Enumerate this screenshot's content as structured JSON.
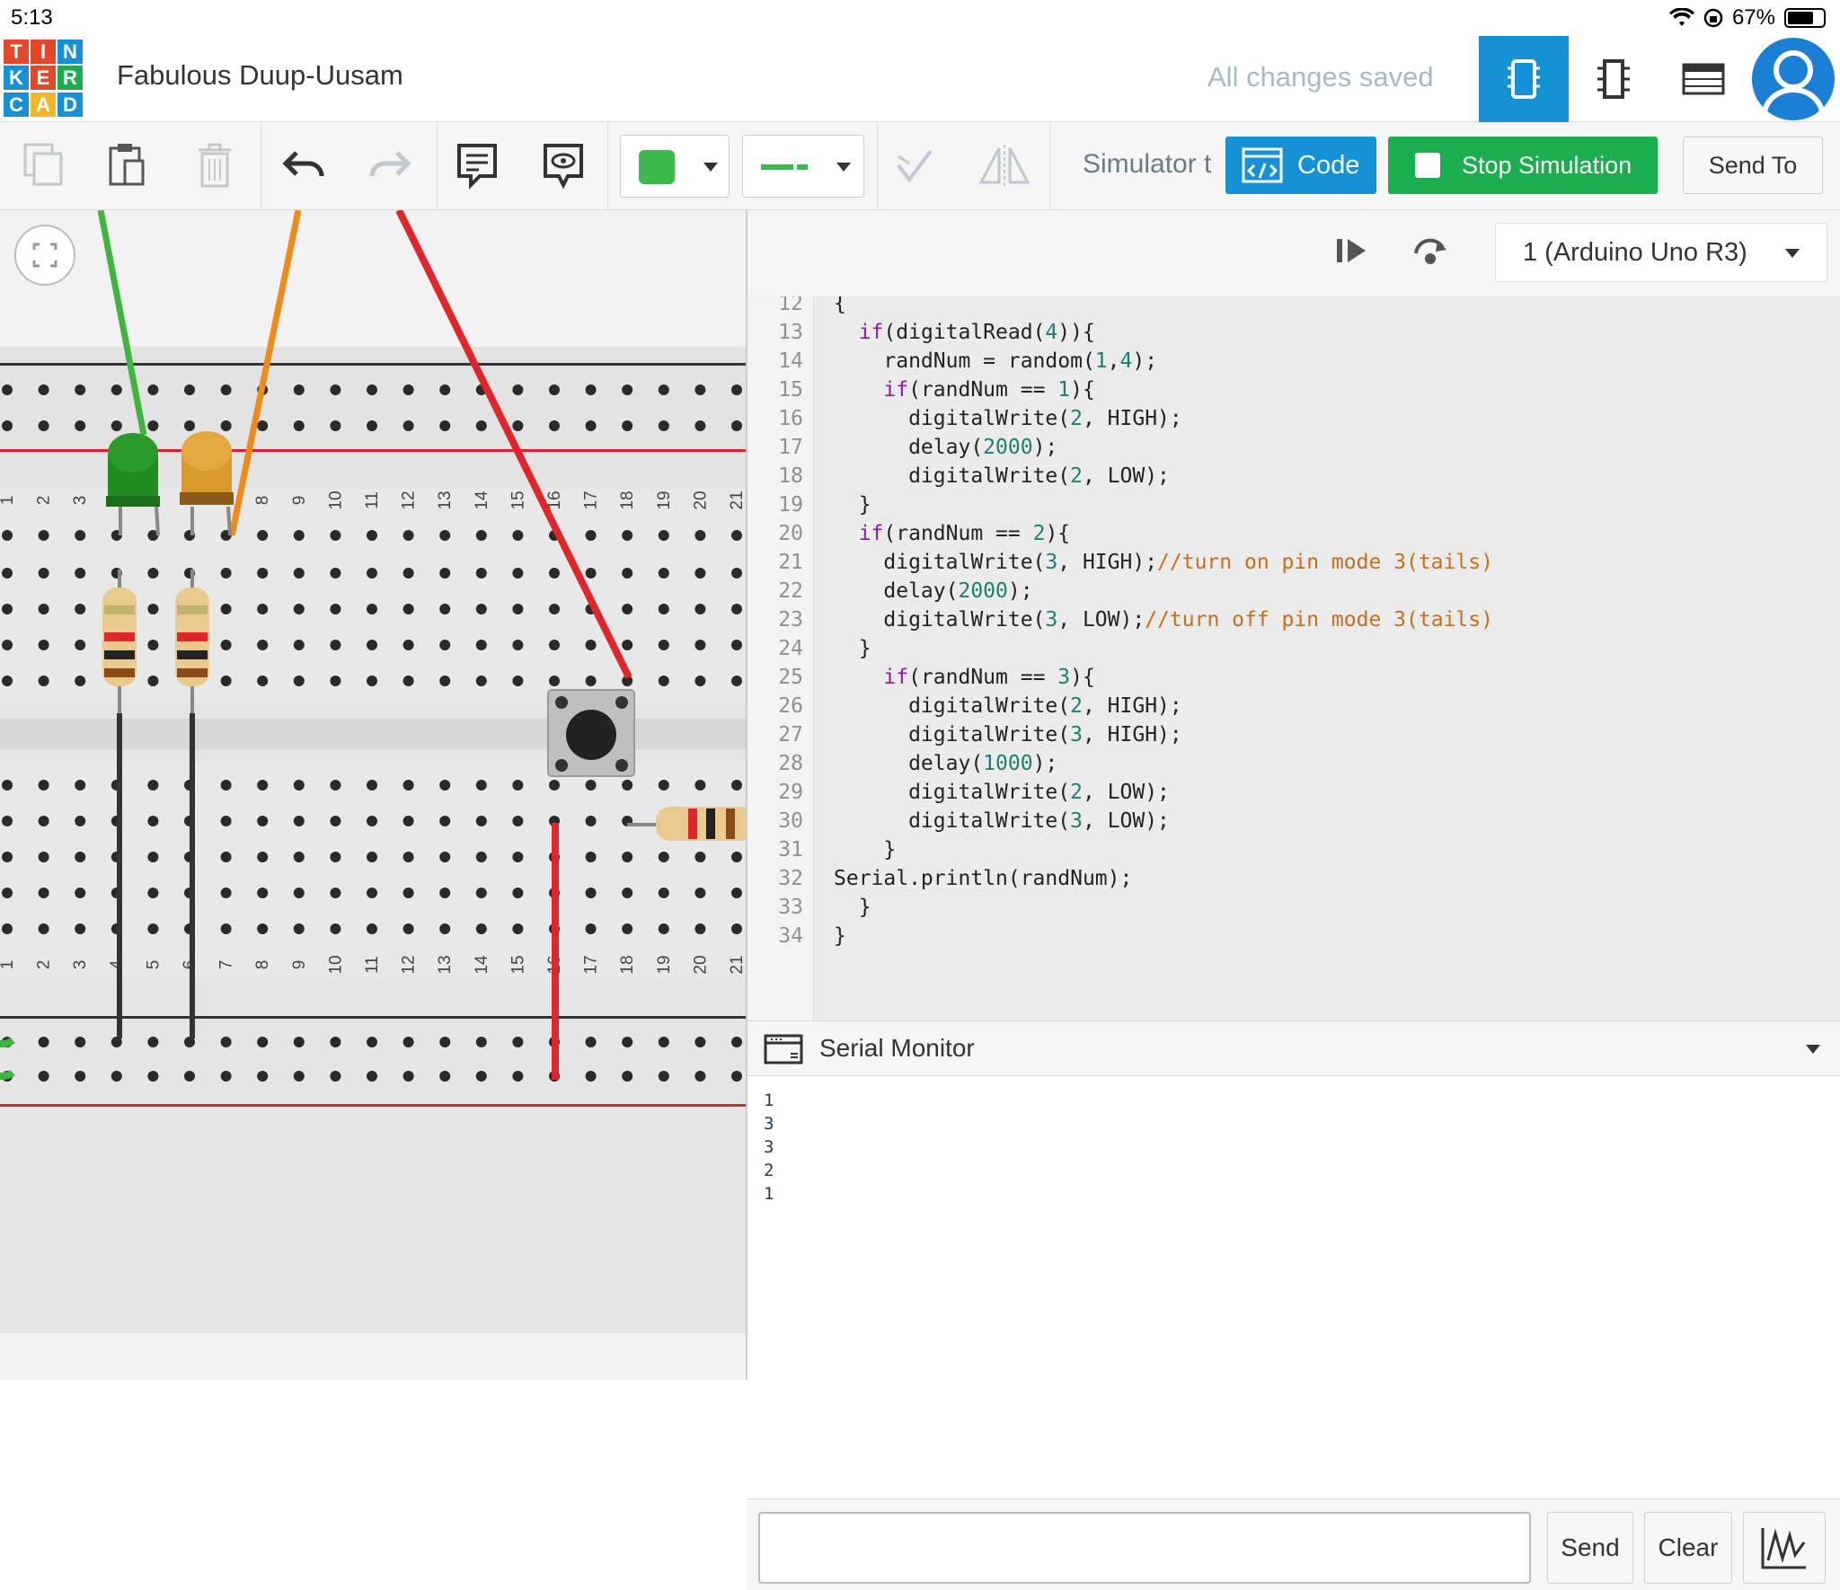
{
  "status_bar": {
    "time": "5:13",
    "battery_percent": "67%"
  },
  "header": {
    "logo_letters": [
      "T",
      "I",
      "N",
      "K",
      "E",
      "R",
      "C",
      "A",
      "D"
    ],
    "logo_colors": [
      "#e2472a",
      "#e2472a",
      "#1591d5",
      "#1591d5",
      "#e2472a",
      "#1bad4f",
      "#1591d5",
      "#f0b626",
      "#1591d5"
    ],
    "project_title": "Fabulous Duup-Uusam",
    "save_status": "All changes saved",
    "view_buttons": [
      "circuit-view-icon",
      "schematic-view-icon",
      "component-list-icon"
    ]
  },
  "toolbar": {
    "tools": [
      "copy-icon",
      "paste-icon",
      "delete-icon",
      "undo-icon",
      "redo-icon",
      "note-icon",
      "notes-visibility-icon"
    ],
    "color_swatch": "#3db84a",
    "simulator_label": "Simulator t",
    "code_label": "Code",
    "stop_label": "Stop Simulation",
    "send_to_label": "Send To"
  },
  "breadboard": {
    "column_numbers": [
      "1",
      "2",
      "3",
      "4",
      "5",
      "6",
      "7",
      "8",
      "9",
      "10",
      "11",
      "12",
      "13",
      "14",
      "15",
      "16",
      "17",
      "18",
      "19",
      "20",
      "21"
    ],
    "wire_colors": {
      "green": "#3fb43f",
      "orange": "#f28a1a",
      "red": "#e0262a",
      "black": "#333333"
    }
  },
  "code_editor": {
    "device": "1 (Arduino Uno R3)",
    "lines": [
      {
        "n": "12",
        "code": [
          [
            "p",
            "{"
          ]
        ]
      },
      {
        "n": "13",
        "code": [
          [
            "p",
            "  "
          ],
          [
            "k",
            "if"
          ],
          [
            "p",
            "(digitalRead("
          ],
          [
            "n",
            "4"
          ],
          [
            "p",
            ")){"
          ]
        ]
      },
      {
        "n": "14",
        "code": [
          [
            "p",
            "    randNum = random("
          ],
          [
            "n",
            "1"
          ],
          [
            "p",
            ","
          ],
          [
            "n",
            "4"
          ],
          [
            "p",
            ");"
          ]
        ]
      },
      {
        "n": "15",
        "code": [
          [
            "p",
            "    "
          ],
          [
            "k",
            "if"
          ],
          [
            "p",
            "(randNum == "
          ],
          [
            "n",
            "1"
          ],
          [
            "p",
            "){"
          ]
        ]
      },
      {
        "n": "16",
        "code": [
          [
            "p",
            "      digitalWrite("
          ],
          [
            "n",
            "2"
          ],
          [
            "p",
            ", HIGH);"
          ]
        ]
      },
      {
        "n": "17",
        "code": [
          [
            "p",
            "      delay("
          ],
          [
            "n",
            "2000"
          ],
          [
            "p",
            ");"
          ]
        ]
      },
      {
        "n": "18",
        "code": [
          [
            "p",
            "      digitalWrite("
          ],
          [
            "n",
            "2"
          ],
          [
            "p",
            ", LOW);"
          ]
        ]
      },
      {
        "n": "19",
        "code": [
          [
            "p",
            "  }"
          ]
        ]
      },
      {
        "n": "20",
        "code": [
          [
            "p",
            "  "
          ],
          [
            "k",
            "if"
          ],
          [
            "p",
            "(randNum == "
          ],
          [
            "n",
            "2"
          ],
          [
            "p",
            "){"
          ]
        ]
      },
      {
        "n": "21",
        "code": [
          [
            "p",
            "    digitalWrite("
          ],
          [
            "n",
            "3"
          ],
          [
            "p",
            ", HIGH);"
          ],
          [
            "c",
            "//turn on pin mode 3(tails)"
          ]
        ]
      },
      {
        "n": "22",
        "code": [
          [
            "p",
            "    delay("
          ],
          [
            "n",
            "2000"
          ],
          [
            "p",
            ");"
          ]
        ]
      },
      {
        "n": "23",
        "code": [
          [
            "p",
            "    digitalWrite("
          ],
          [
            "n",
            "3"
          ],
          [
            "p",
            ", LOW);"
          ],
          [
            "c",
            "//turn off pin mode 3(tails)"
          ]
        ]
      },
      {
        "n": "24",
        "code": [
          [
            "p",
            "  }"
          ]
        ]
      },
      {
        "n": "25",
        "code": [
          [
            "p",
            "    "
          ],
          [
            "k",
            "if"
          ],
          [
            "p",
            "(randNum == "
          ],
          [
            "n",
            "3"
          ],
          [
            "p",
            "){"
          ]
        ]
      },
      {
        "n": "26",
        "code": [
          [
            "p",
            "      digitalWrite("
          ],
          [
            "n",
            "2"
          ],
          [
            "p",
            ", HIGH);"
          ]
        ]
      },
      {
        "n": "27",
        "code": [
          [
            "p",
            "      digitalWrite("
          ],
          [
            "n",
            "3"
          ],
          [
            "p",
            ", HIGH);"
          ]
        ]
      },
      {
        "n": "28",
        "code": [
          [
            "p",
            "      delay("
          ],
          [
            "n",
            "1000"
          ],
          [
            "p",
            ");"
          ]
        ]
      },
      {
        "n": "29",
        "code": [
          [
            "p",
            "      digitalWrite("
          ],
          [
            "n",
            "2"
          ],
          [
            "p",
            ", LOW);"
          ]
        ]
      },
      {
        "n": "30",
        "code": [
          [
            "p",
            "      digitalWrite("
          ],
          [
            "n",
            "3"
          ],
          [
            "p",
            ", LOW);"
          ]
        ]
      },
      {
        "n": "31",
        "code": [
          [
            "p",
            "    }"
          ]
        ]
      },
      {
        "n": "32",
        "code": [
          [
            "p",
            "Serial.println(randNum);"
          ]
        ]
      },
      {
        "n": "33",
        "code": [
          [
            "p",
            "  }"
          ]
        ]
      },
      {
        "n": "34",
        "code": [
          [
            "p",
            "}"
          ]
        ]
      }
    ]
  },
  "serial_monitor": {
    "title": "Serial Monitor",
    "output": [
      "1",
      "3",
      "3",
      "2",
      "1"
    ],
    "input_value": "",
    "send_label": "Send",
    "clear_label": "Clear",
    "graph_icon": "graph-icon"
  }
}
